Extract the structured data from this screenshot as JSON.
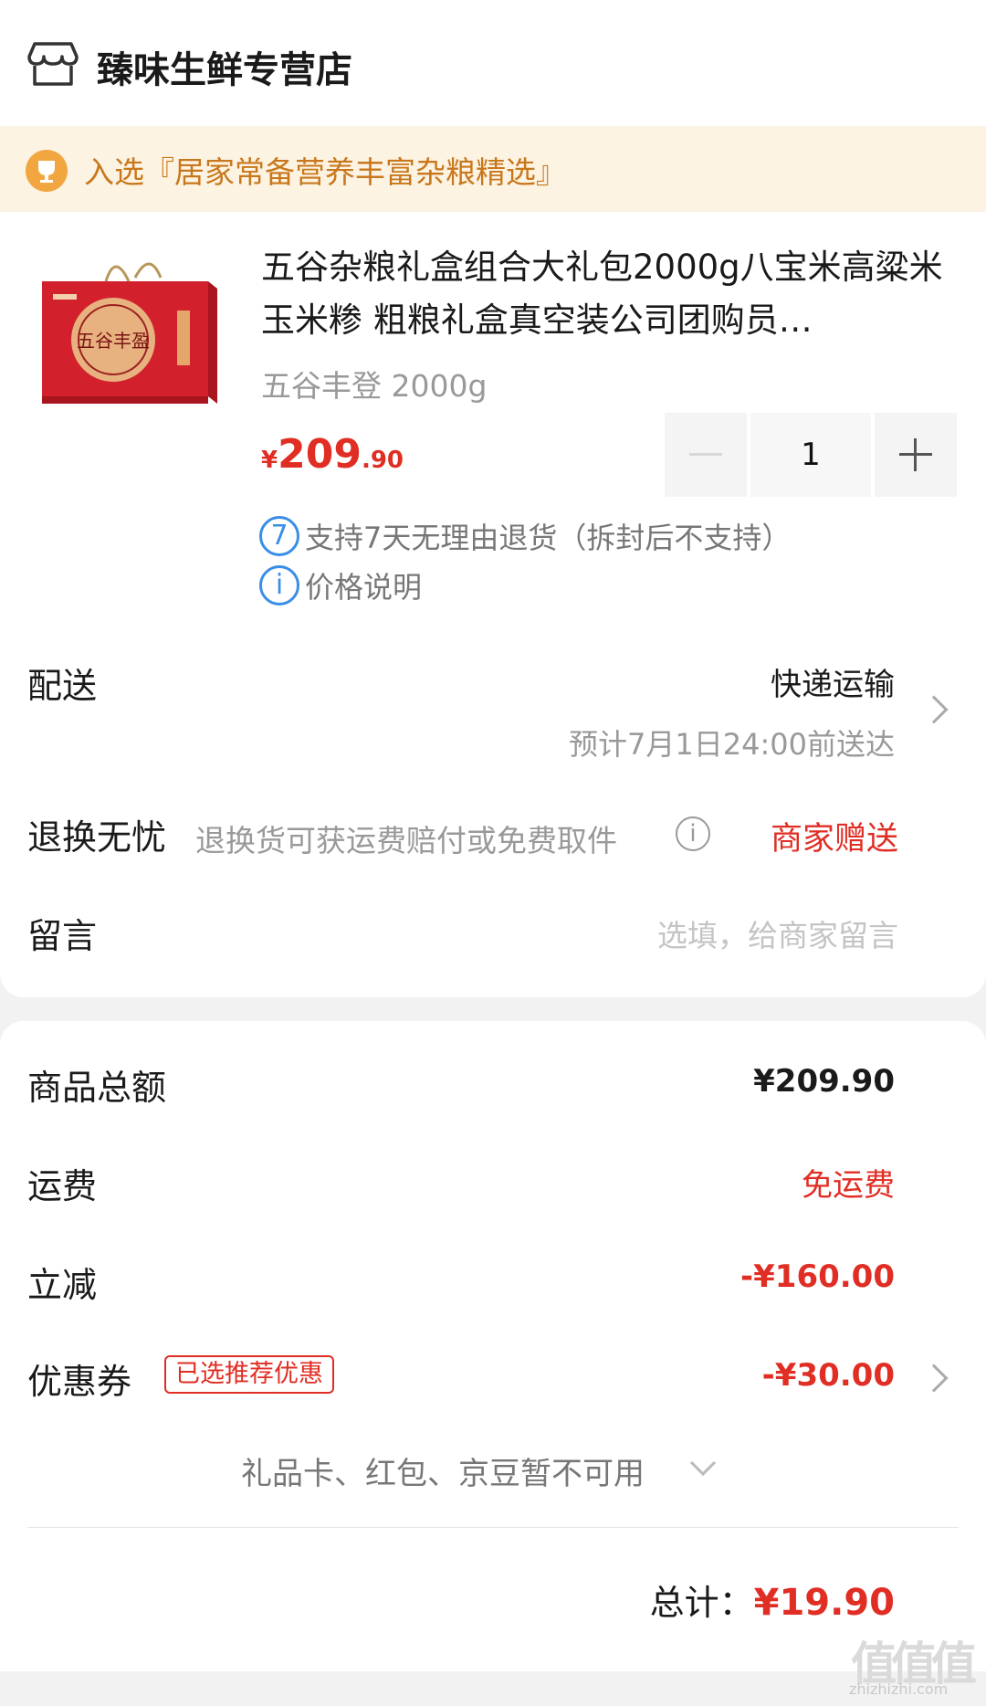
{
  "store": {
    "name": "臻味生鲜专营店",
    "icon": "store-icon"
  },
  "banner": {
    "icon": "trophy-icon",
    "text": "入选『居家常备营养丰富杂粮精选』"
  },
  "product": {
    "title": "五谷杂粮礼盒组合大礼包2000g八宝米高粱米玉米糁 粗粮礼盒真空装公司团购员…",
    "spec": "五谷丰登 2000g",
    "price": {
      "currency": "¥",
      "integer": "209",
      "decimal": ".90"
    },
    "image_text": "五谷丰盈",
    "quantity": "1",
    "features": [
      {
        "icon": "seven-day-icon",
        "icon_text": "7",
        "text": "支持7天无理由退货（拆封后不支持）"
      },
      {
        "icon": "info-icon",
        "icon_text": "i",
        "text": "价格说明"
      }
    ]
  },
  "delivery": {
    "label": "配送",
    "method": "快递运输",
    "eta": "预计7月1日24:00前送达"
  },
  "return_worry_free": {
    "label": "退换无忧",
    "desc": "退换货可获运费赔付或免费取件",
    "info_icon_text": "i",
    "value": "商家赠送"
  },
  "message": {
    "label": "留言",
    "placeholder": "选填，给商家留言"
  },
  "summary": {
    "goods_total": {
      "label": "商品总额",
      "value": "¥209.90"
    },
    "shipping": {
      "label": "运费",
      "value": "免运费"
    },
    "instant_discount": {
      "label": "立减",
      "value": "-¥160.00"
    },
    "coupon": {
      "label": "优惠券",
      "badge": "已选推荐优惠",
      "value": "-¥30.00"
    },
    "unavailable": "礼品卡、红包、京豆暂不可用",
    "total_label": "总计：",
    "total_value": "¥19.90"
  },
  "watermark": {
    "text": "zhizhizhi.com",
    "glyphs": "值值值"
  },
  "colors": {
    "accent_red": "#e02e24",
    "banner_bg": "#fdf3e3",
    "banner_text": "#c8781c",
    "icon_blue": "#3a8ee6"
  }
}
